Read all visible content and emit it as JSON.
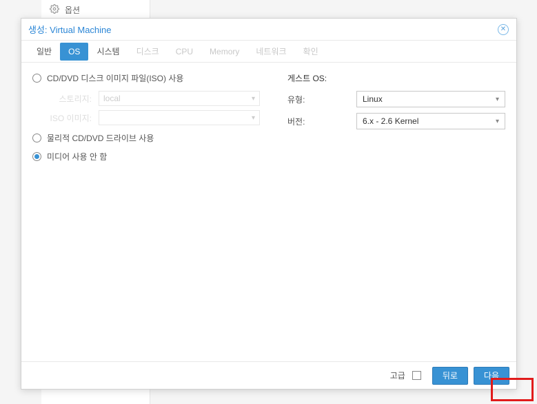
{
  "sidebar": {
    "options_label": "옵션"
  },
  "dialog": {
    "title": "생성: Virtual Machine",
    "tabs": [
      {
        "label": "일반",
        "state": "normal"
      },
      {
        "label": "OS",
        "state": "active"
      },
      {
        "label": "시스템",
        "state": "normal"
      },
      {
        "label": "디스크",
        "state": "disabled"
      },
      {
        "label": "CPU",
        "state": "disabled"
      },
      {
        "label": "Memory",
        "state": "disabled"
      },
      {
        "label": "네트워크",
        "state": "disabled"
      },
      {
        "label": "확인",
        "state": "disabled"
      }
    ],
    "media": {
      "iso": {
        "label": "CD/DVD 디스크 이미지 파일(ISO) 사용",
        "storage_label": "스토리지:",
        "storage_value": "local",
        "image_label": "ISO 이미지:",
        "image_value": ""
      },
      "physical": {
        "label": "물리적 CD/DVD 드라이브 사용"
      },
      "none": {
        "label": "미디어 사용 안 함",
        "checked": true
      }
    },
    "guest": {
      "section_title": "게스트 OS:",
      "type_label": "유형:",
      "type_value": "Linux",
      "version_label": "버전:",
      "version_value": "6.x - 2.6 Kernel"
    },
    "footer": {
      "advanced_label": "고급",
      "back_label": "뒤로",
      "next_label": "다음"
    }
  }
}
